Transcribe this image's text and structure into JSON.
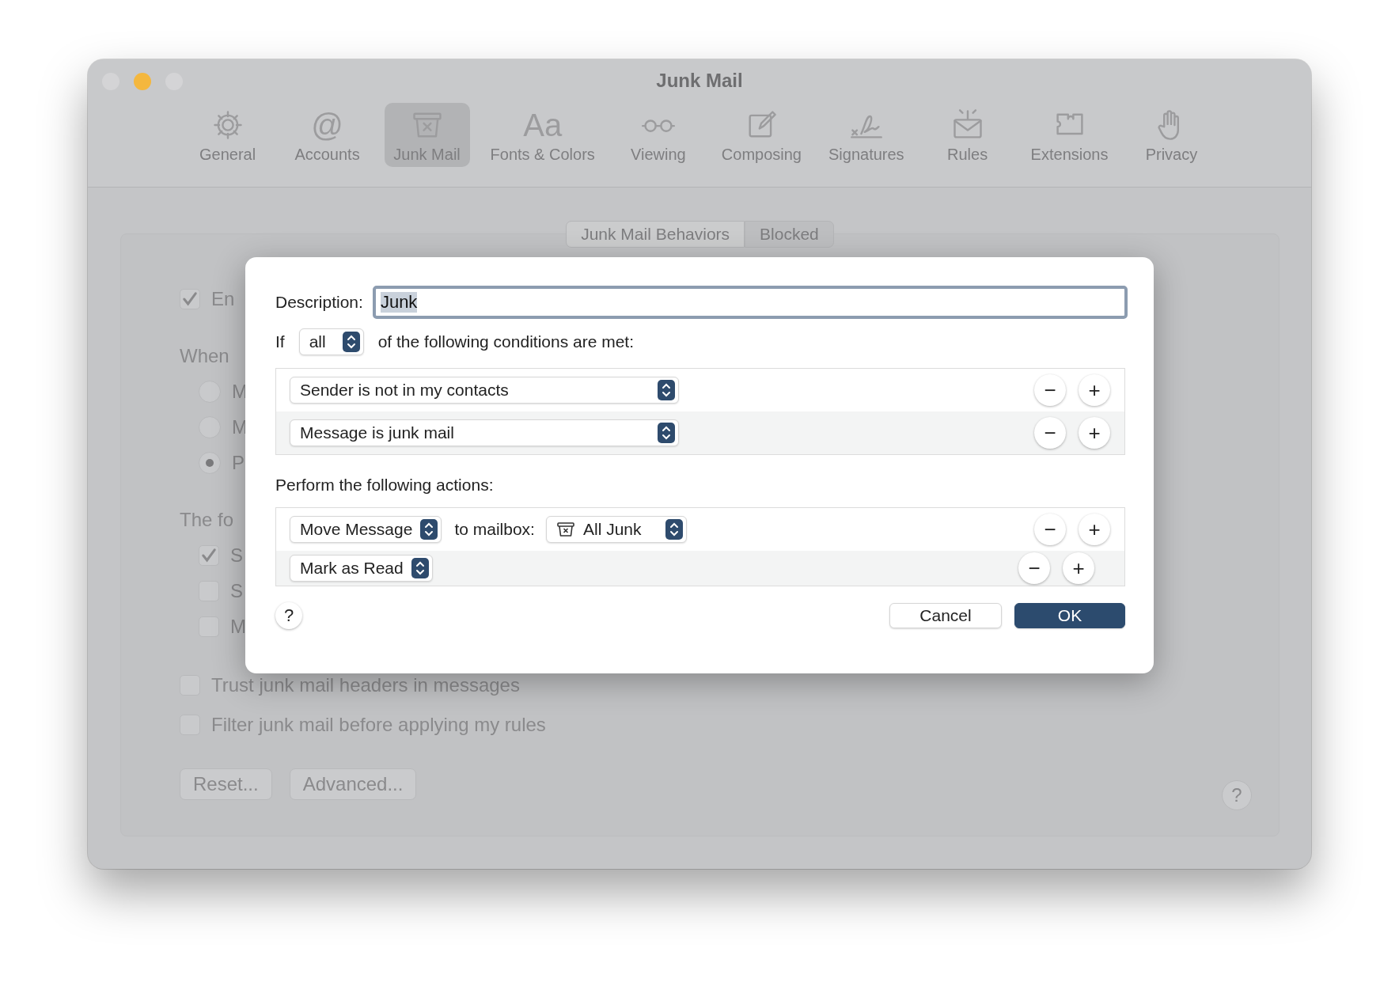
{
  "window": {
    "title": "Junk Mail",
    "traffic_lights": [
      {
        "color": "#d4d4d6"
      },
      {
        "color": "#f4b73e"
      },
      {
        "color": "#d4d4d6"
      }
    ]
  },
  "toolbar": [
    {
      "label": "General",
      "selected": false
    },
    {
      "label": "Accounts",
      "selected": false,
      "glyph": "@"
    },
    {
      "label": "Junk Mail",
      "selected": true
    },
    {
      "label": "Fonts & Colors",
      "selected": false,
      "glyph": "Aa"
    },
    {
      "label": "Viewing",
      "selected": false
    },
    {
      "label": "Composing",
      "selected": false
    },
    {
      "label": "Signatures",
      "selected": false
    },
    {
      "label": "Rules",
      "selected": false
    },
    {
      "label": "Extensions",
      "selected": false
    },
    {
      "label": "Privacy",
      "selected": false
    }
  ],
  "segments": [
    {
      "label": "Junk Mail Behaviors",
      "selected": true
    },
    {
      "label": "Blocked",
      "selected": false
    }
  ],
  "settings": {
    "enable": {
      "label": "En",
      "checked": true
    },
    "when_label": "When",
    "radios": [
      {
        "label": "M",
        "selected": false
      },
      {
        "label": "M",
        "selected": false
      },
      {
        "label": "P",
        "selected": true
      }
    ],
    "following_label": "The fo",
    "options": [
      {
        "label": "S",
        "checked": true
      },
      {
        "label": "S",
        "checked": false
      },
      {
        "label": "M",
        "checked": false
      }
    ],
    "checkboxes": [
      {
        "label": "Trust junk mail headers in messages",
        "checked": false
      },
      {
        "label": "Filter junk mail before applying my rules",
        "checked": false
      }
    ],
    "buttons": [
      "Reset...",
      "Advanced..."
    ],
    "help": "?"
  },
  "sheet": {
    "description": {
      "label": "Description:",
      "value": "Junk",
      "text_selected": true
    },
    "if_label": "If",
    "match": "all",
    "conditions_label": "of the following conditions are met:",
    "conditions": [
      {
        "field": "Sender is not in my contacts",
        "remove": "−",
        "add": "+"
      },
      {
        "field": "Message is junk mail",
        "remove": "−",
        "add": "+"
      }
    ],
    "actions_label": "Perform the following actions:",
    "actions": [
      {
        "kind": "move",
        "action": "Move Message",
        "to_label": "to mailbox:",
        "mailbox": "All Junk",
        "remove": "−",
        "add": "+"
      },
      {
        "kind": "mark",
        "action": "Mark as Read",
        "remove": "−",
        "add": "+"
      }
    ],
    "help": "?",
    "cancel": "Cancel",
    "ok": "OK"
  }
}
